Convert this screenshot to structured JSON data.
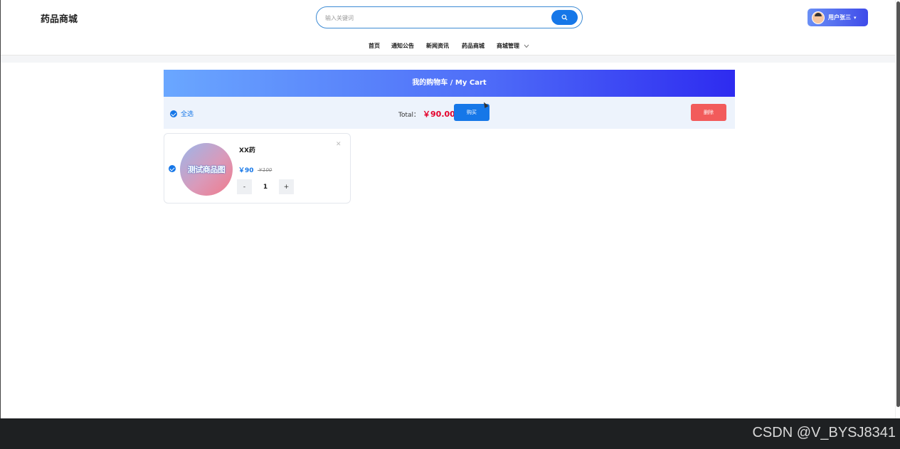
{
  "header": {
    "logo": "药品商城",
    "search": {
      "placeholder": "输入关键词"
    },
    "user": {
      "label": "用户张三"
    }
  },
  "nav": {
    "items": [
      {
        "label": "首页"
      },
      {
        "label": "通知公告"
      },
      {
        "label": "新闻资讯"
      },
      {
        "label": "药品商城"
      },
      {
        "label": "商城管理"
      }
    ]
  },
  "cart": {
    "title": "我的购物车 / My Cart",
    "select_all_label": "全选",
    "total_label": "Total：",
    "total_value": "￥90.00",
    "buy_label": "购买",
    "delete_label": "删除",
    "items": [
      {
        "image_text": "测试商品图",
        "name": "XX药",
        "price": "￥90",
        "old_price": "￥100",
        "quantity": "1",
        "checked": true
      }
    ]
  },
  "stepper": {
    "minus": "-",
    "plus": "+"
  },
  "footer": {
    "watermark": "CSDN @V_BYSJ8341"
  },
  "colors": {
    "accent": "#1677e8",
    "danger": "#f25b5b",
    "price": "#e4002b"
  }
}
